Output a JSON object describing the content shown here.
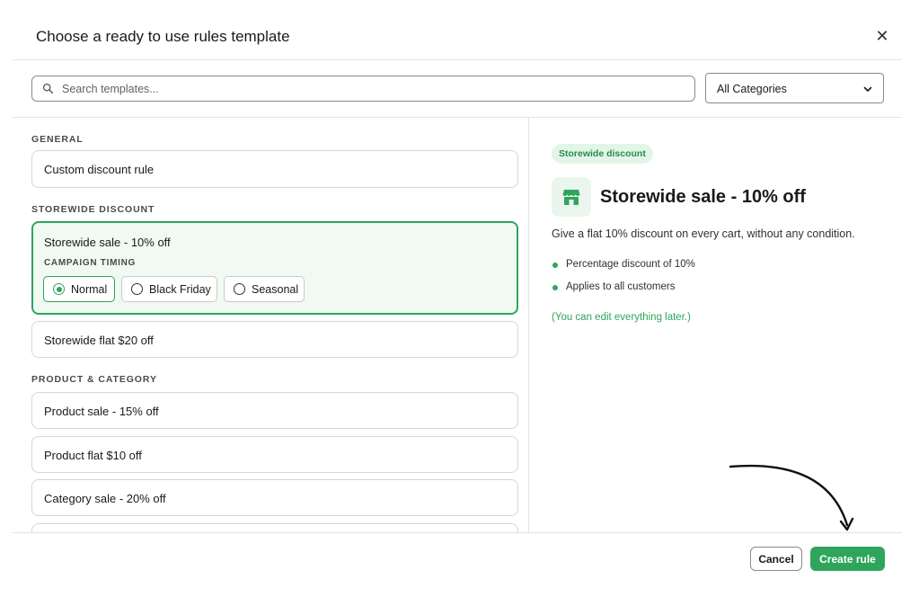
{
  "modal": {
    "title": "Choose a ready to use rules template",
    "close_icon": "close-icon"
  },
  "search": {
    "placeholder": "Search templates...",
    "value": "",
    "icon": "search-icon"
  },
  "category_filter": {
    "selected": "All Categories",
    "icon": "chevron-down-icon"
  },
  "template_list": {
    "sections": {
      "general": {
        "label": "GENERAL",
        "items": [
          "Custom discount rule"
        ]
      },
      "storewide": {
        "label": "STOREWIDE DISCOUNT",
        "items": [
          "Storewide sale - 10% off",
          "Storewide flat $20 off"
        ]
      },
      "product": {
        "label": "PRODUCT & CATEGORY",
        "items": [
          "Product sale - 15% off",
          "Product flat $10 off",
          "Category sale - 20% off"
        ]
      }
    },
    "selected_item": "Storewide sale - 10% off",
    "campaign_timing": {
      "label": "CAMPAIGN TIMING",
      "options": [
        "Normal",
        "Black Friday",
        "Seasonal"
      ],
      "selected": "Normal"
    }
  },
  "detail": {
    "tag": "Storewide discount",
    "icon": "storefront-icon",
    "title": "Storewide sale - 10% off",
    "description": "Give a flat 10% discount on every cart, without any condition.",
    "bullets": [
      "Percentage discount of 10%",
      "Applies to all customers"
    ],
    "edit_note": "(You can edit everything later.)"
  },
  "footer": {
    "cancel_label": "Cancel",
    "create_label": "Create rule"
  },
  "colors": {
    "accent": "#2fa55b",
    "tag_bg": "#e2f6e8",
    "selected_bg": "#f1f9f3",
    "border": "#d6d6d6",
    "text": "#1a1a1a"
  }
}
